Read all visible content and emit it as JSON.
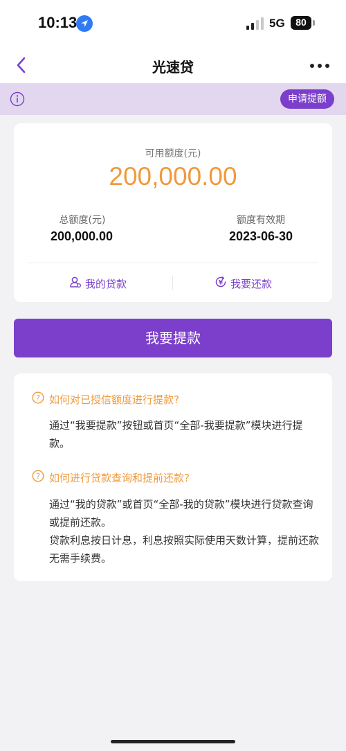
{
  "status_bar": {
    "time": "10:13",
    "network": "5G",
    "battery": "80",
    "location_icon": "location-arrow-icon",
    "signal_icon": "cell-signal-icon"
  },
  "nav": {
    "title": "光速贷",
    "back_icon": "chevron-left-icon",
    "more_icon": "more-horizontal-icon"
  },
  "notice": {
    "icon": "info-icon",
    "apply_button": "申请提额"
  },
  "quota": {
    "available_label": "可用额度(元)",
    "available_value": "200,000.00",
    "total_label": "总额度(元)",
    "total_value": "200,000.00",
    "expiry_label": "额度有效期",
    "expiry_value": "2023-06-30",
    "my_loans": "我的贷款",
    "repay": "我要还款"
  },
  "withdraw_button": "我要提款",
  "faq": [
    {
      "question": "如何对已授信额度进行提款?",
      "answer": "通过“我要提款”按钮或首页“全部-我要提款”模块进行提款。"
    },
    {
      "question": "如何进行贷款查询和提前还款?",
      "answer": "通过“我的贷款”或首页“全部-我的贷款”模块进行贷款查询或提前还款。\n贷款利息按日计息，利息按照实际使用天数计算，提前还款无需手续费。"
    }
  ],
  "colors": {
    "accent": "#7b3fcb",
    "highlight": "#f09a3e",
    "notice_bg": "#e2d7ef",
    "page_bg": "#f2f2f4"
  }
}
